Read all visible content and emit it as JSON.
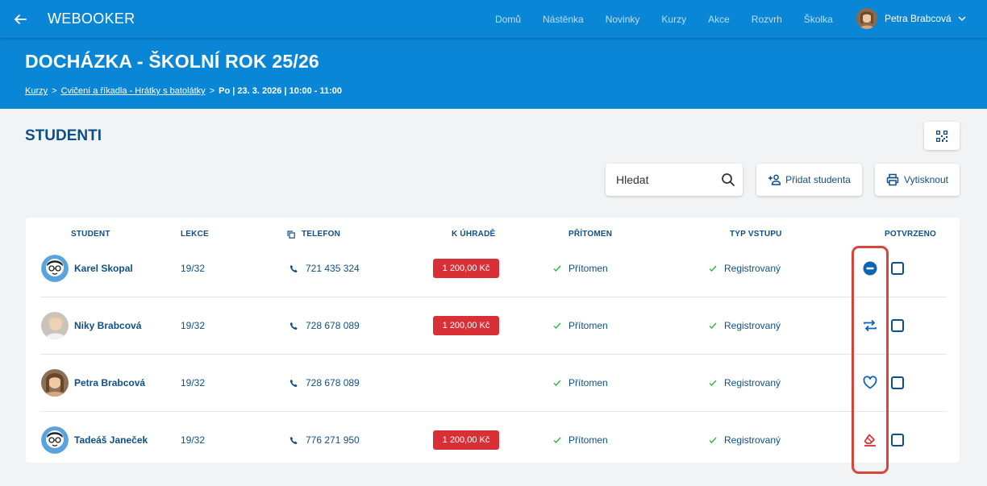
{
  "app": {
    "brand": "WEBOOKER"
  },
  "nav": {
    "items": [
      "Domů",
      "Nástěnka",
      "Novinky",
      "Kurzy",
      "Akce",
      "Rozvrh",
      "Školka"
    ]
  },
  "user": {
    "name": "Petra Brabcová"
  },
  "header": {
    "title": "DOCHÁZKA - ŠKOLNÍ ROK 25/26",
    "breadcrumb": {
      "item1": "Kurzy",
      "item2": "Cvičení a říkadla - Hrátky s batolátky",
      "separator": ">",
      "current": "Po | 23. 3. 2026 | 10:00 - 11:00"
    }
  },
  "section": {
    "title": "STUDENTI"
  },
  "toolbar": {
    "search_placeholder": "Hledat",
    "add_label": "Přidat studenta",
    "print_label": "Vytisknout"
  },
  "table": {
    "headers": {
      "student": "STUDENT",
      "lekce": "LEKCE",
      "telefon": "TELEFON",
      "k_uhrade": "K ÚHRADĚ",
      "pritomen": "PŘÍTOMEN",
      "typ_vstupu": "TYP VSTUPU",
      "potvrzeno": "POTVRZENO"
    },
    "rows": [
      {
        "name": "Karel Skopal",
        "lekce": "19/32",
        "phone": "721 435 324",
        "price": "1 200,00 Kč",
        "present": "Přítomen",
        "entry": "Registrovaný",
        "status_icon": "minus-circle-icon",
        "confirmed": false
      },
      {
        "name": "Niky Brabcová",
        "lekce": "19/32",
        "phone": "728 678 089",
        "price": "1 200,00 Kč",
        "present": "Přítomen",
        "entry": "Registrovaný",
        "status_icon": "repeat-icon",
        "confirmed": false
      },
      {
        "name": "Petra Brabcová",
        "lekce": "19/32",
        "phone": "728 678 089",
        "price": "",
        "present": "Přítomen",
        "entry": "Registrovaný",
        "status_icon": "heart-icon",
        "confirmed": false
      },
      {
        "name": "Tadeáš Janeček",
        "lekce": "19/32",
        "phone": "776 271 950",
        "price": "1 200,00 Kč",
        "present": "Přítomen",
        "entry": "Registrovaný",
        "status_icon": "eraser-icon",
        "confirmed": false
      }
    ]
  },
  "colors": {
    "primary": "#0a86d6",
    "text_dark": "#0d4f86",
    "badge_red": "#d93038",
    "check_green": "#2bb24c",
    "highlight": "#d8453a"
  }
}
